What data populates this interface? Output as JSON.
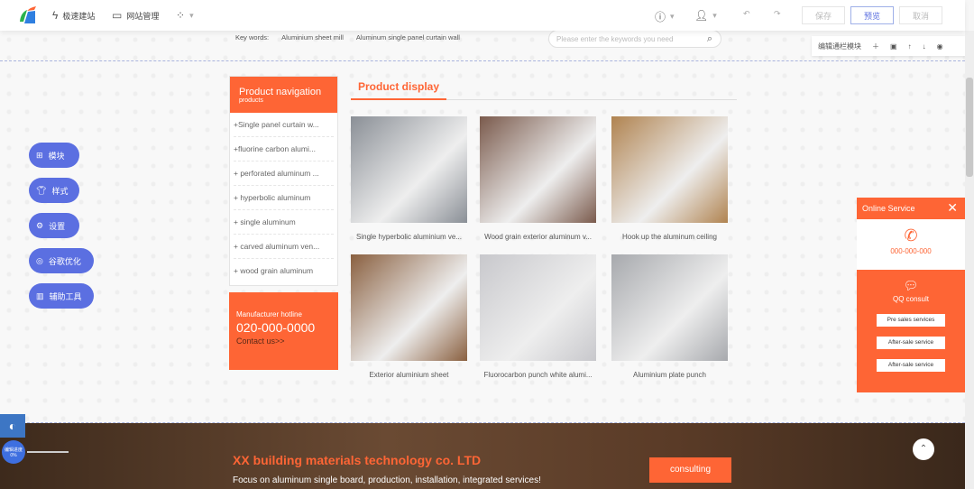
{
  "topbar": {
    "nav": [
      {
        "label": "极速建站",
        "icon": "lightning-icon"
      },
      {
        "label": "网站管理",
        "icon": "window-icon"
      },
      {
        "label": "",
        "icon": "apps-grid-icon"
      }
    ],
    "save": "保存",
    "preview": "预览",
    "cancel": "取消"
  },
  "header": {
    "keywords_label": "Key words:",
    "keywords": [
      "Aluminium sheet mill",
      "Aluminum single panel curtain wall"
    ],
    "search_placeholder": "Please enter the keywords you need"
  },
  "editbar": {
    "label": "编辑通栏模块"
  },
  "sidebar": {
    "title": "Product navigation",
    "subtitle": "products",
    "items": [
      "+Single panel curtain w...",
      "+fluorine carbon alumi...",
      "+ perforated aluminum ...",
      "+ hyperbolic aluminum",
      "+ single aluminum",
      "+ carved aluminum ven...",
      "+ wood grain aluminum"
    ],
    "hotline_label": "Manufacturer hotline",
    "hotline": "020-000-0000",
    "contact": "Contact us>>"
  },
  "products": {
    "title": "Product display",
    "items": [
      {
        "caption": "Single hyperbolic aluminium ve...",
        "color": "#8a8f96"
      },
      {
        "caption": "Wood grain exterior aluminum v...",
        "color": "#7a5a4c"
      },
      {
        "caption": "Hook up the aluminum ceiling",
        "color": "#b08350"
      },
      {
        "caption": "Exterior aluminium sheet",
        "color": "#8a6040"
      },
      {
        "caption": "Fluorocarbon punch white alumi...",
        "color": "#c8c8cc"
      },
      {
        "caption": "Aluminium plate punch",
        "color": "#a7a9ad"
      }
    ]
  },
  "floating_tools": [
    {
      "label": "模块",
      "icon": "grid-icon"
    },
    {
      "label": "样式",
      "icon": "shirt-icon"
    },
    {
      "label": "设置",
      "icon": "gear-icon"
    },
    {
      "label": "谷歌优化",
      "icon": "chrome-icon"
    },
    {
      "label": "辅助工具",
      "icon": "tools-icon"
    }
  ],
  "service": {
    "title": "Online Service",
    "phone": "000-000-000",
    "qq": "QQ consult",
    "buttons": [
      "Pre sales services",
      "After-sale service",
      "After-sale service"
    ]
  },
  "progress": {
    "label": "编辑进度",
    "value": "0%"
  },
  "footer": {
    "company": "XX building materials technology co. LTD",
    "slogan": "Focus on aluminum single board, production, installation, integrated services!",
    "consult": "consulting"
  },
  "colors": {
    "accent": "#fe6535",
    "tool": "#5b6fe1"
  }
}
